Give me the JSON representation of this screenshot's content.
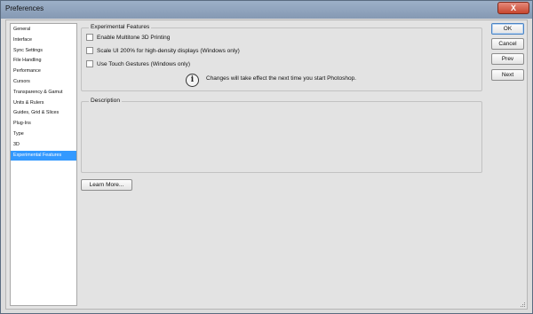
{
  "window": {
    "title": "Preferences"
  },
  "sidebar": {
    "items": [
      {
        "label": "General"
      },
      {
        "label": "Interface"
      },
      {
        "label": "Sync Settings"
      },
      {
        "label": "File Handling"
      },
      {
        "label": "Performance"
      },
      {
        "label": "Cursors"
      },
      {
        "label": "Transparency & Gamut"
      },
      {
        "label": "Units & Rulers"
      },
      {
        "label": "Guides, Grid & Slices"
      },
      {
        "label": "Plug-Ins"
      },
      {
        "label": "Type"
      },
      {
        "label": "3D"
      },
      {
        "label": "Experimental Features",
        "selected": true
      }
    ]
  },
  "features": {
    "legend": "Experimental Features",
    "options": [
      {
        "label": "Enable Multitone 3D Printing",
        "checked": false
      },
      {
        "label": "Scale UI 200% for high-density displays (Windows only)",
        "checked": false
      },
      {
        "label": "Use Touch Gestures (Windows only)",
        "checked": false
      }
    ],
    "info_text": "Changes will take effect the next time you start Photoshop.",
    "info_icon": "info-icon"
  },
  "description": {
    "legend": "Description"
  },
  "buttons": {
    "learn_more": "Learn More...",
    "ok": "OK",
    "cancel": "Cancel",
    "prev": "Prev",
    "next": "Next",
    "close": "X"
  },
  "colors": {
    "selection": "#3399ff",
    "titlebar": "#8fa3bd",
    "close": "#c8472f"
  }
}
